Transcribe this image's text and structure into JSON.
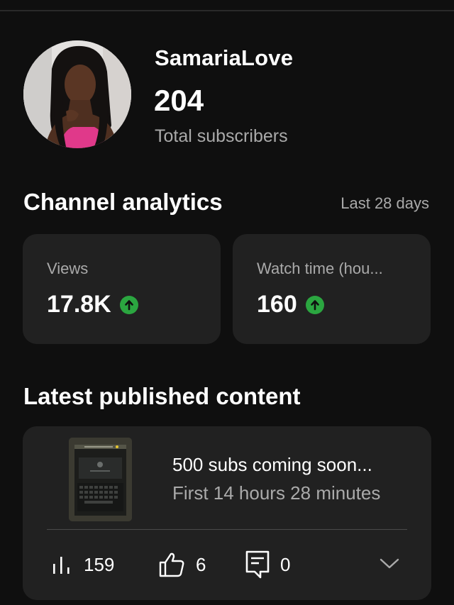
{
  "channel": {
    "name": "SamariaLove",
    "subscriber_count": "204",
    "subscriber_label": "Total subscribers"
  },
  "analytics": {
    "title": "Channel analytics",
    "range": "Last 28 days",
    "metrics": [
      {
        "label": "Views",
        "value": "17.8K",
        "trend": "up",
        "trend_color": "#2ba640"
      },
      {
        "label": "Watch time (hou...",
        "value": "160",
        "trend": "up",
        "trend_color": "#2ba640"
      }
    ]
  },
  "latest": {
    "title": "Latest published content",
    "video": {
      "title": "500 subs coming soon...",
      "meta": "First 14 hours 28 minutes",
      "views": "159",
      "likes": "6",
      "comments": "0"
    }
  },
  "icons": {
    "views": "bar-chart-icon",
    "likes": "thumbs-up-icon",
    "comments": "comment-icon",
    "trend": "arrow-up-circle-icon",
    "expand": "chevron-down-icon"
  }
}
